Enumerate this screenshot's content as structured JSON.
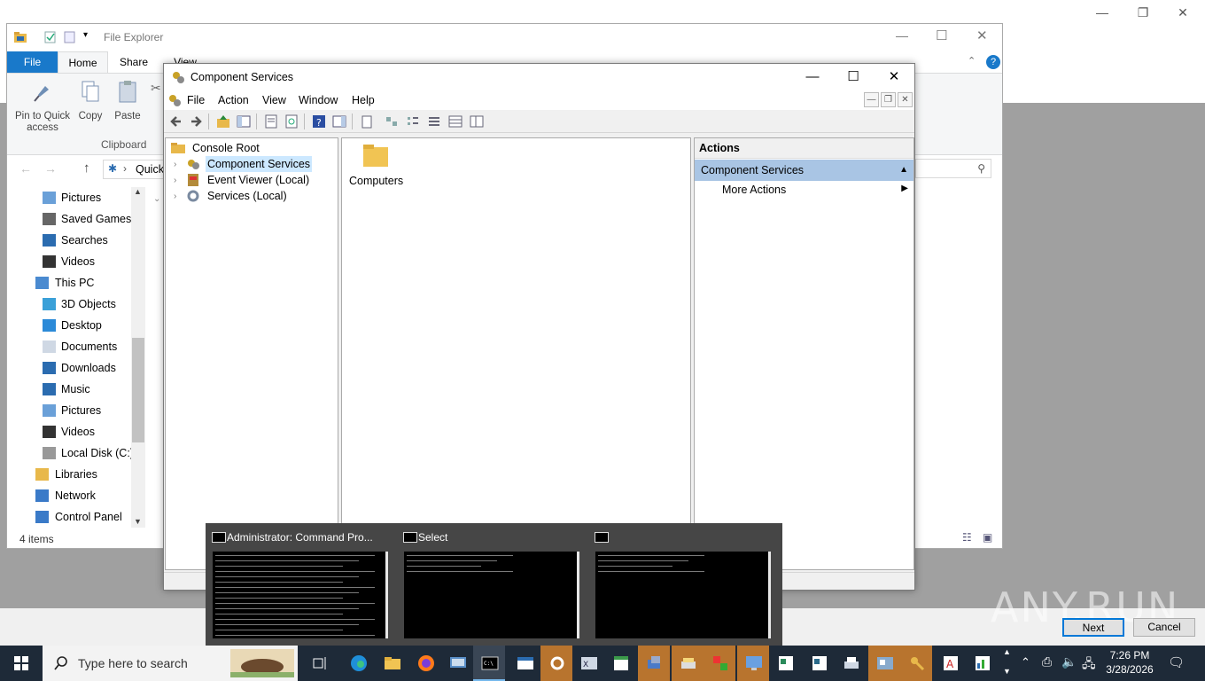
{
  "file_explorer": {
    "title": "File Explorer",
    "tabs": [
      "File",
      "Home",
      "Share",
      "View"
    ],
    "ribbon": {
      "pin_label_line1": "Pin to Quick",
      "pin_label_line2": "access",
      "copy_label": "Copy",
      "paste_label": "Paste",
      "group_label": "Clipboard"
    },
    "address_text": "Quick",
    "nav_items": [
      {
        "label": "Pictures",
        "icon": "pictures-icon"
      },
      {
        "label": "Saved Games",
        "icon": "saved-games-icon"
      },
      {
        "label": "Searches",
        "icon": "search-icon"
      },
      {
        "label": "Videos",
        "icon": "videos-icon"
      },
      {
        "label": "This PC",
        "icon": "computer-icon"
      },
      {
        "label": "3D Objects",
        "icon": "3d-objects-icon"
      },
      {
        "label": "Desktop",
        "icon": "desktop-icon"
      },
      {
        "label": "Documents",
        "icon": "documents-icon"
      },
      {
        "label": "Downloads",
        "icon": "downloads-icon"
      },
      {
        "label": "Music",
        "icon": "music-icon"
      },
      {
        "label": "Pictures",
        "icon": "pictures-icon"
      },
      {
        "label": "Videos",
        "icon": "videos-icon"
      },
      {
        "label": "Local Disk (C:)",
        "icon": "disk-icon"
      },
      {
        "label": "Libraries",
        "icon": "libraries-icon"
      },
      {
        "label": "Network",
        "icon": "network-icon"
      },
      {
        "label": "Control Panel",
        "icon": "control-panel-icon"
      }
    ],
    "status": "4 items"
  },
  "component_services": {
    "title": "Component Services",
    "menu": [
      "File",
      "Action",
      "View",
      "Window",
      "Help"
    ],
    "tree": {
      "root": "Console Root",
      "items": [
        "Component Services",
        "Event Viewer (Local)",
        "Services (Local)"
      ]
    },
    "content_items": [
      "Computers"
    ],
    "actions": {
      "header": "Actions",
      "section": "Component Services",
      "more": "More Actions"
    }
  },
  "preview": {
    "windows": [
      "Administrator: Command Pro...",
      "Select",
      ""
    ]
  },
  "dialog": {
    "next": "Next",
    "cancel": "Cancel",
    "watermark": "ANY.RUN"
  },
  "taskbar": {
    "search_placeholder": "Type here to search",
    "time": "7:26 PM",
    "date": "3/28/2026"
  },
  "colors": {
    "accent": "#0078d7",
    "file_tab": "#1979ca",
    "taskbar": "#1e2a38",
    "actions_selected": "#a9c5e4"
  }
}
